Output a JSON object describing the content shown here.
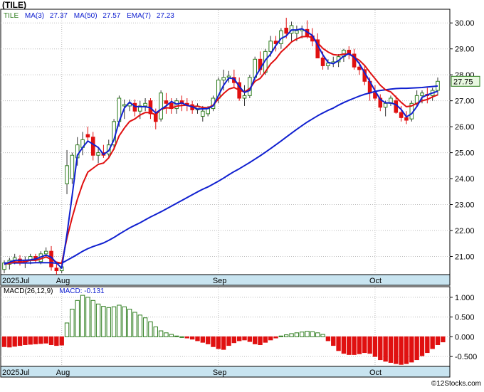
{
  "title": "(TILE)",
  "footer": "©12Stocks.com",
  "colors": {
    "up": "#2e7d1e",
    "down": "#e01010",
    "ma_blue": "#1020d0",
    "ema_red": "#e01010",
    "axis_band": "#c8e4f0",
    "last_label_bg": "#e8f8e0"
  },
  "chart_data": [
    {
      "type": "candlestick",
      "legend": {
        "ticker": "TILE",
        "ma3_label": "MA(3)",
        "ma3_value": "27.37",
        "ma50_label": "MA(50)",
        "ma50_value": "27.57",
        "ema7_label": "EMA(7)",
        "ema7_value": "27.23"
      },
      "last_price_label": "27.75",
      "last_price": 27.75,
      "ylim": [
        20.3,
        30.5
      ],
      "yticks": [
        21.0,
        22.0,
        23.0,
        24.0,
        25.0,
        26.0,
        27.0,
        28.0,
        29.0,
        30.0
      ],
      "ytick_labels": [
        "21.00",
        "22.00",
        "23.00",
        "24.00",
        "25.00",
        "26.00",
        "27.00",
        "28.00",
        "29.00",
        "30.00"
      ],
      "xticks": [
        {
          "label": "2025Jul",
          "index": 0
        },
        {
          "label": "Aug",
          "index": 11
        },
        {
          "label": "Sep",
          "index": 41
        },
        {
          "label": "Oct",
          "index": 71
        }
      ],
      "ohlc": [
        [
          20.5,
          20.85,
          20.35,
          20.75
        ],
        [
          20.7,
          20.95,
          20.5,
          20.85
        ],
        [
          20.85,
          21.1,
          20.7,
          20.95
        ],
        [
          20.9,
          21.05,
          20.65,
          20.75
        ],
        [
          20.75,
          21.0,
          20.55,
          20.85
        ],
        [
          20.85,
          21.1,
          20.7,
          21.0
        ],
        [
          21.0,
          21.1,
          20.75,
          20.85
        ],
        [
          20.8,
          21.2,
          20.7,
          21.1
        ],
        [
          21.1,
          21.35,
          20.95,
          21.2
        ],
        [
          21.2,
          21.4,
          20.45,
          20.6
        ],
        [
          20.55,
          20.75,
          20.3,
          20.45
        ],
        [
          20.45,
          20.75,
          20.35,
          20.6
        ],
        [
          23.8,
          25.1,
          23.4,
          24.5
        ],
        [
          24.0,
          25.0,
          23.8,
          24.9
        ],
        [
          24.8,
          25.6,
          24.5,
          25.3
        ],
        [
          25.2,
          25.8,
          24.9,
          25.5
        ],
        [
          25.7,
          26.0,
          25.4,
          25.6
        ],
        [
          25.6,
          25.8,
          24.7,
          24.9
        ],
        [
          24.9,
          25.2,
          24.6,
          25.0
        ],
        [
          25.0,
          25.3,
          24.8,
          24.9
        ],
        [
          24.95,
          25.5,
          24.85,
          25.3
        ],
        [
          25.3,
          26.3,
          25.1,
          26.2
        ],
        [
          26.2,
          27.2,
          26.0,
          27.1
        ],
        [
          26.8,
          27.05,
          26.3,
          26.85
        ],
        [
          26.8,
          27.05,
          26.6,
          26.9
        ],
        [
          26.9,
          27.05,
          26.4,
          26.6
        ],
        [
          26.6,
          27.0,
          26.3,
          26.8
        ],
        [
          26.8,
          27.1,
          26.6,
          26.9
        ],
        [
          27.0,
          27.1,
          26.3,
          26.5
        ],
        [
          26.5,
          26.7,
          25.9,
          26.2
        ],
        [
          26.3,
          27.4,
          26.2,
          27.3
        ],
        [
          27.0,
          27.3,
          26.5,
          26.9
        ],
        [
          26.9,
          27.1,
          26.5,
          26.7
        ],
        [
          26.7,
          27.1,
          26.5,
          27.0
        ],
        [
          27.0,
          27.2,
          26.6,
          26.9
        ],
        [
          26.9,
          27.1,
          26.6,
          26.85
        ],
        [
          26.85,
          27.0,
          26.5,
          26.65
        ],
        [
          26.65,
          26.9,
          26.5,
          26.8
        ],
        [
          26.4,
          26.8,
          26.2,
          26.6
        ],
        [
          26.5,
          26.8,
          26.4,
          26.7
        ],
        [
          26.7,
          27.2,
          26.6,
          27.1
        ],
        [
          27.1,
          27.9,
          26.9,
          27.8
        ],
        [
          27.8,
          28.2,
          27.4,
          27.9
        ],
        [
          27.9,
          28.15,
          27.7,
          27.95
        ],
        [
          27.9,
          28.2,
          27.5,
          27.7
        ],
        [
          27.7,
          27.9,
          27.0,
          27.1
        ],
        [
          27.1,
          27.6,
          26.8,
          27.2
        ],
        [
          27.2,
          28.0,
          27.1,
          27.9
        ],
        [
          27.9,
          28.7,
          27.8,
          28.6
        ],
        [
          28.6,
          28.9,
          28.0,
          28.2
        ],
        [
          28.1,
          29.0,
          28.0,
          28.9
        ],
        [
          28.9,
          29.5,
          28.7,
          29.3
        ],
        [
          29.3,
          29.5,
          28.9,
          29.2
        ],
        [
          29.2,
          29.8,
          29.0,
          29.7
        ],
        [
          29.8,
          30.2,
          29.4,
          29.6
        ],
        [
          29.6,
          30.05,
          29.3,
          29.9
        ],
        [
          29.6,
          29.9,
          29.3,
          29.7
        ],
        [
          29.7,
          29.9,
          29.4,
          29.75
        ],
        [
          29.75,
          30.1,
          29.4,
          29.5
        ],
        [
          29.5,
          29.8,
          29.1,
          29.3
        ],
        [
          29.35,
          29.6,
          28.7,
          28.65
        ],
        [
          28.65,
          28.9,
          28.2,
          28.35
        ],
        [
          28.35,
          28.6,
          28.2,
          28.45
        ],
        [
          28.45,
          28.7,
          28.3,
          28.5
        ],
        [
          28.5,
          28.8,
          28.3,
          28.7
        ],
        [
          28.7,
          29.0,
          28.5,
          28.95
        ],
        [
          28.95,
          29.1,
          28.6,
          28.8
        ],
        [
          28.8,
          29.0,
          28.2,
          28.3
        ],
        [
          28.3,
          28.5,
          28.0,
          28.2
        ],
        [
          28.2,
          28.35,
          27.6,
          27.75
        ],
        [
          27.75,
          27.9,
          27.0,
          27.3
        ],
        [
          27.3,
          27.6,
          27.0,
          27.1
        ],
        [
          27.1,
          27.25,
          26.6,
          26.75
        ],
        [
          26.75,
          27.0,
          26.4,
          26.9
        ],
        [
          26.9,
          27.2,
          26.8,
          27.1
        ],
        [
          27.0,
          27.2,
          26.5,
          26.55
        ],
        [
          26.55,
          26.8,
          26.2,
          26.35
        ],
        [
          26.35,
          26.6,
          26.1,
          26.25
        ],
        [
          26.3,
          27.0,
          26.2,
          26.9
        ],
        [
          26.9,
          27.4,
          26.8,
          27.2
        ],
        [
          27.2,
          27.4,
          26.9,
          27.3
        ],
        [
          27.25,
          27.5,
          26.9,
          27.2
        ],
        [
          27.2,
          27.5,
          27.0,
          27.4
        ],
        [
          27.4,
          27.9,
          27.2,
          27.75
        ]
      ],
      "ma3": [
        20.7,
        20.78,
        20.85,
        20.85,
        20.85,
        20.87,
        20.9,
        20.98,
        21.05,
        20.97,
        20.75,
        20.55,
        21.85,
        23.35,
        24.9,
        25.2,
        25.45,
        25.33,
        25.2,
        24.93,
        25.07,
        25.5,
        26.2,
        26.72,
        26.95,
        26.78,
        26.77,
        26.77,
        26.73,
        26.53,
        26.67,
        26.8,
        26.97,
        26.87,
        26.92,
        26.82,
        26.77,
        26.68,
        26.69,
        26.7,
        26.8,
        27.2,
        27.6,
        27.88,
        27.85,
        27.55,
        27.32,
        27.4,
        27.9,
        28.23,
        28.57,
        28.8,
        29.13,
        29.4,
        29.5,
        29.73,
        29.73,
        29.78,
        29.65,
        29.52,
        29.15,
        28.77,
        28.48,
        28.43,
        28.55,
        28.72,
        28.82,
        28.68,
        28.43,
        28.08,
        27.75,
        27.38,
        27.05,
        26.92,
        26.92,
        26.85,
        26.67,
        26.38,
        26.5,
        26.78,
        27.13,
        27.23,
        27.3,
        27.37
      ],
      "ema7": [
        20.7,
        20.74,
        20.79,
        20.78,
        20.8,
        20.85,
        20.85,
        20.91,
        20.98,
        20.89,
        20.78,
        20.74,
        21.7,
        22.5,
        23.2,
        23.8,
        24.25,
        24.4,
        24.55,
        24.6,
        24.8,
        25.15,
        25.65,
        25.95,
        26.2,
        26.3,
        26.45,
        26.55,
        26.54,
        26.46,
        26.67,
        26.73,
        26.72,
        26.79,
        26.82,
        26.83,
        26.78,
        26.79,
        26.74,
        26.73,
        26.83,
        27.07,
        27.28,
        27.45,
        27.51,
        27.41,
        27.34,
        27.47,
        27.75,
        27.86,
        28.12,
        28.42,
        28.61,
        28.88,
        29.06,
        29.27,
        29.38,
        29.47,
        29.48,
        29.44,
        29.24,
        29.02,
        28.88,
        28.78,
        28.76,
        28.8,
        28.8,
        28.68,
        28.56,
        28.36,
        28.1,
        27.85,
        27.6,
        27.42,
        27.34,
        27.14,
        26.94,
        26.77,
        26.8,
        26.9,
        27.0,
        27.05,
        27.15,
        27.23
      ],
      "ma50": [
        20.75,
        20.75,
        20.75,
        20.75,
        20.75,
        20.75,
        20.76,
        20.76,
        20.76,
        20.76,
        20.74,
        20.74,
        20.85,
        20.96,
        21.08,
        21.2,
        21.3,
        21.38,
        21.45,
        21.52,
        21.62,
        21.73,
        21.86,
        21.98,
        22.1,
        22.2,
        22.3,
        22.41,
        22.52,
        22.62,
        22.72,
        22.83,
        22.94,
        23.05,
        23.16,
        23.27,
        23.38,
        23.49,
        23.59,
        23.68,
        23.79,
        23.9,
        24.02,
        24.15,
        24.27,
        24.38,
        24.5,
        24.62,
        24.75,
        24.88,
        25.02,
        25.16,
        25.3,
        25.45,
        25.6,
        25.75,
        25.9,
        26.04,
        26.18,
        26.3,
        26.42,
        26.53,
        26.63,
        26.72,
        26.83,
        26.93,
        27.02,
        27.1,
        27.18,
        27.25,
        27.3,
        27.36,
        27.4,
        27.42,
        27.45,
        27.47,
        27.48,
        27.48,
        27.49,
        27.5,
        27.51,
        27.53,
        27.55,
        27.57
      ]
    },
    {
      "type": "bar",
      "legend": {
        "label": "MACD(26,12,9)",
        "value_label": "MACD:",
        "value": "-0.131"
      },
      "ylim": [
        -0.75,
        1.25
      ],
      "yticks": [
        -0.5,
        0.0,
        0.5,
        1.0
      ],
      "ytick_labels": [
        "-0.500",
        "0.000",
        "0.500",
        "1.000"
      ],
      "xticks": [
        {
          "label": "2025Jul",
          "index": 0
        },
        {
          "label": "Aug",
          "index": 11
        },
        {
          "label": "Sep",
          "index": 41
        },
        {
          "label": "Oct",
          "index": 71
        }
      ],
      "values": [
        -0.25,
        -0.26,
        -0.24,
        -0.22,
        -0.2,
        -0.19,
        -0.18,
        -0.17,
        -0.16,
        -0.2,
        -0.22,
        -0.21,
        0.35,
        0.7,
        0.92,
        1.05,
        1.0,
        0.92,
        0.83,
        0.77,
        0.74,
        0.76,
        0.8,
        0.76,
        0.7,
        0.62,
        0.55,
        0.48,
        0.38,
        0.25,
        0.15,
        0.1,
        0.06,
        0.02,
        0.0,
        -0.03,
        -0.06,
        -0.1,
        -0.14,
        -0.18,
        -0.25,
        -0.3,
        -0.32,
        -0.22,
        -0.15,
        -0.1,
        -0.08,
        -0.12,
        -0.18,
        -0.2,
        -0.14,
        -0.08,
        -0.03,
        0.02,
        0.05,
        0.08,
        0.1,
        0.12,
        0.14,
        0.13,
        0.1,
        0.06,
        -0.1,
        -0.22,
        -0.35,
        -0.42,
        -0.45,
        -0.45,
        -0.43,
        -0.4,
        -0.42,
        -0.5,
        -0.58,
        -0.62,
        -0.65,
        -0.68,
        -0.7,
        -0.68,
        -0.64,
        -0.58,
        -0.48,
        -0.4,
        -0.3,
        -0.2,
        -0.13
      ]
    }
  ]
}
